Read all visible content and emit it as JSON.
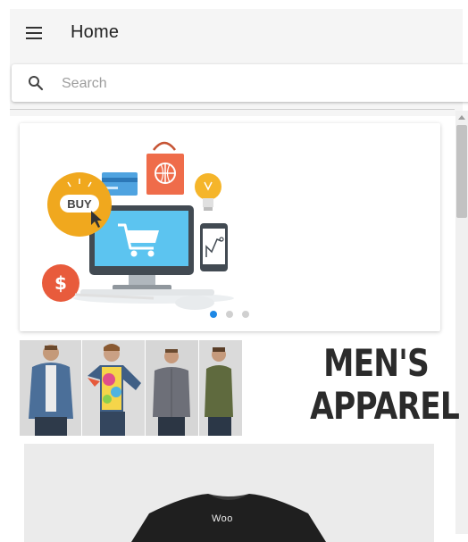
{
  "header": {
    "title": "Home",
    "menu_icon": "hamburger-menu-icon"
  },
  "search": {
    "placeholder": "Search",
    "value": "",
    "icon": "search-icon"
  },
  "carousel": {
    "badge_text": "BUY",
    "currency_symbol": "$",
    "slide_count": 3,
    "active_slide": 1,
    "colors": {
      "accent": "#1e88e5",
      "buy_circle": "#f0a81e",
      "dollar_circle": "#e85b3c",
      "bag": "#ef6c4a",
      "monitor": "#5cc4f0",
      "bulb": "#f5b52a"
    }
  },
  "category": {
    "line1": "MEN'S",
    "line2": "APPAREL"
  },
  "product": {
    "print_text": "Woo"
  }
}
